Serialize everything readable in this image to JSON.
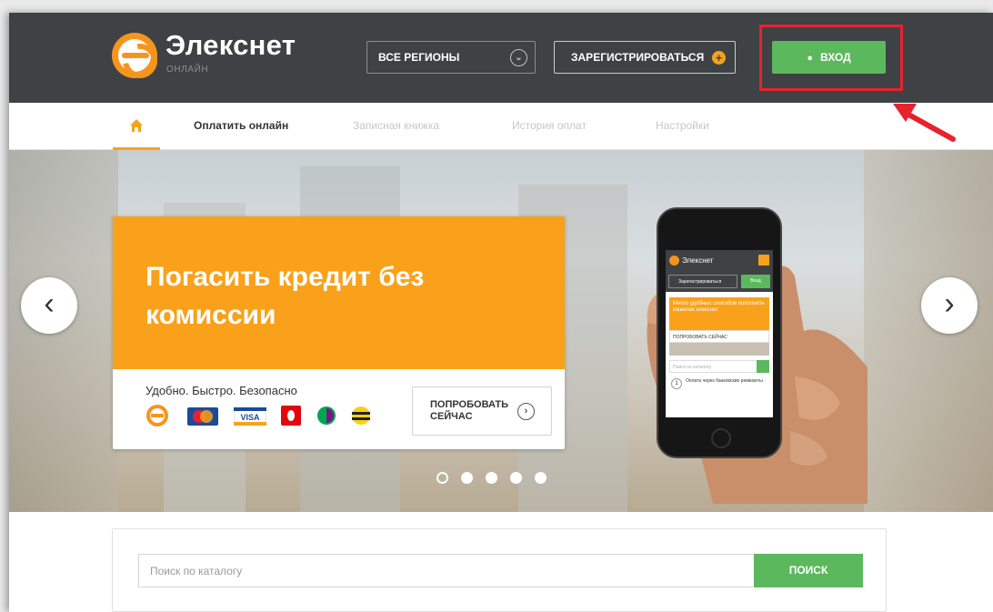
{
  "header": {
    "brand": "Элекснет",
    "brand_sub": "ОНЛАЙН",
    "region_label": "ВСЕ РЕГИОНЫ",
    "register_label": "ЗАРЕГИСТРИРОВАТЬСЯ",
    "login_label": "ВХОД"
  },
  "nav": {
    "items": [
      {
        "label": "Оплатить онлайн",
        "active": true
      },
      {
        "label": "Записная книжка",
        "active": false
      },
      {
        "label": "История оплат",
        "active": false
      },
      {
        "label": "Настройки",
        "active": false
      }
    ]
  },
  "hero": {
    "title": "Погасить кредит без комиссии",
    "subtitle": "Удобно. Быстро. Безопасно",
    "try_line1": "ПОПРОБОВАТЬ",
    "try_line2": "СЕЙЧАС",
    "payment_icons": [
      "elecsnet-icon",
      "mastercard-icon",
      "visa-icon",
      "mts-icon",
      "megafon-icon",
      "beeline-icon"
    ],
    "slides_total": 5,
    "active_slide": 1
  },
  "phone_screen": {
    "brand": "Элекснет",
    "register": "Зарегистрироваться",
    "login": "Вход",
    "banner": "Много удобных способов пополнить кошелек элекснет",
    "try": "ПОПРОБОВАТЬ СЕЙЧАС",
    "search_placeholder": "Поиск по каталогу",
    "item_number": "1",
    "item_text": "Оплата через банковские реквизиты"
  },
  "search": {
    "placeholder": "Поиск по каталогу",
    "button": "ПОИСК"
  },
  "colors": {
    "header_bg": "#3e4244",
    "orange": "#f9a11b",
    "green": "#5cb85c",
    "highlight_red": "#e8212e"
  }
}
